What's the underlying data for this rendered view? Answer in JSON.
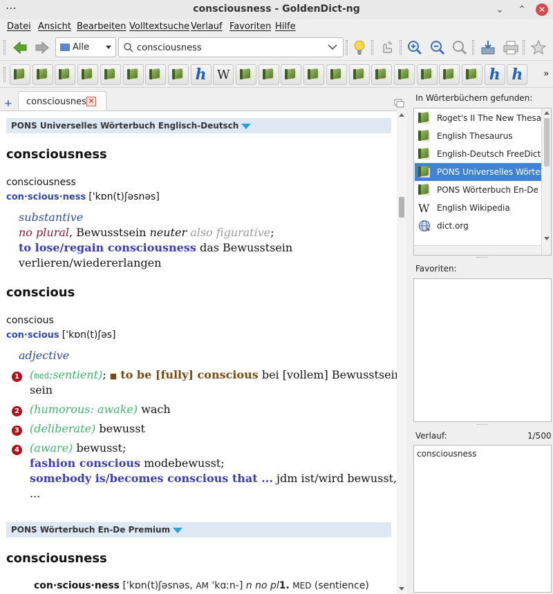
{
  "window": {
    "title": "consciousness - GoldenDict-ng",
    "menu_dots": "⋯",
    "minimize": "⌄",
    "maximize": "⌃",
    "close": "✕"
  },
  "menu": {
    "items": [
      "Datei",
      "Ansicht",
      "Bearbeiten",
      "Volltextsuche",
      "Verlauf",
      "Favoriten",
      "Hilfe"
    ]
  },
  "toolbar": {
    "group_selected": "Alle",
    "search_value": "consciousness",
    "icons": [
      "back-arrow-icon",
      "forward-arrow-icon",
      "lightbulb-icon",
      "scan-popup-icon",
      "zoom-in-icon",
      "zoom-out-icon",
      "zoom-reset-icon",
      "save-article-icon",
      "print-icon",
      "favorite-star-icon"
    ]
  },
  "dictbar": {
    "more": "»"
  },
  "tabs": {
    "active": "consciousness",
    "add": "+",
    "close": "✕"
  },
  "article": {
    "sections": [
      {
        "dictionary": "PONS Universelles Wörterbuch Englisch-Deutsch"
      },
      {
        "dictionary": "PONS Wörterbuch En-De Premium"
      }
    ],
    "entry1": {
      "headword": "consciousness",
      "word": "consciousness",
      "syllables": "con·scious·ness",
      "ipa": "['kɒn(t)ʃəsnəs]",
      "pos": "substantive",
      "no_plural": "no plural",
      "comma": ",",
      "translation": "Bewusstsein",
      "gender": "neuter",
      "also_fig": "also figurative",
      "semicolon": ";",
      "phrase": "to lose/regain consciousness",
      "phrase_trans_1": "das Bewusstsein",
      "phrase_trans_2": "verlieren/wiedererlangen"
    },
    "entry2": {
      "headword": "conscious",
      "word": "conscious",
      "syllables": "con·scious",
      "ipa": "['kɒn(t)ʃəs]",
      "pos": "adjective",
      "senses": [
        {
          "num": "1",
          "open": "(",
          "tag": "med",
          "colon": ":",
          "label": "sentient)",
          "sep": ";",
          "square": "■",
          "phrase": "to be [fully] conscious",
          "trans": "bei [vollem] Bewusstsein",
          "trans_cont": "sein"
        },
        {
          "num": "2",
          "label": "(humorous: awake)",
          "trans": "wach"
        },
        {
          "num": "3",
          "label": "(deliberate)",
          "trans": "bewusst"
        },
        {
          "num": "4",
          "label": "(aware)",
          "trans": "bewusst;",
          "ex1": "fashion conscious",
          "ex1_trans": "modebewusst;",
          "ex2": "somebody is/becomes conscious that ...",
          "ex2_trans": "jdm ist/wird bewusst, dass",
          "ex2_cont": "..."
        }
      ]
    },
    "entry3": {
      "headword": "consciousness",
      "syllables": "con·scious·ness",
      "ipa": "['kɒn(t)ʃəsnəs,",
      "am": "AM",
      "ipa_am": "'kɑːn-]",
      "no_pl": "n no pl",
      "one": "1.",
      "med": "MED",
      "sentience": "(sentience)"
    }
  },
  "right": {
    "found_label": "In Wörterbüchern gefunden:",
    "found": [
      {
        "label": "Roget's II The New Thesaurus",
        "icon": "book-icon"
      },
      {
        "label": "English Thesaurus",
        "icon": "book-icon"
      },
      {
        "label": "English-Deutsch FreeDict+WikDict",
        "icon": "book-icon"
      },
      {
        "label": "PONS Universelles Wörterbuch",
        "icon": "book-icon"
      },
      {
        "label": "PONS Wörterbuch En-De Premium",
        "icon": "book-icon"
      },
      {
        "label": "English Wikipedia",
        "icon": "wikipedia-icon"
      },
      {
        "label": "dict.org",
        "icon": "globe-icon"
      }
    ],
    "favorites_label": "Favoriten:",
    "history_label": "Verlauf:",
    "history_count": "1/500",
    "history_items": [
      "consciousness"
    ]
  }
}
